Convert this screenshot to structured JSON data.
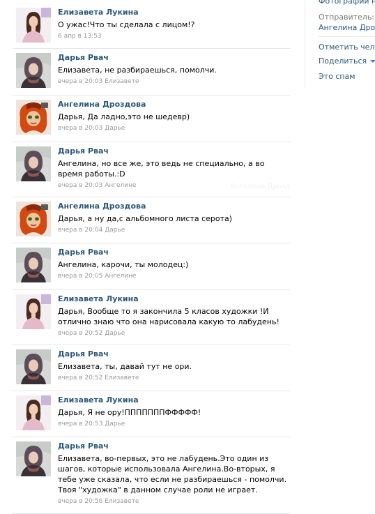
{
  "sidebar": {
    "top_link": "Фотографии на",
    "sender_label": "Отправитель:",
    "sender_name": "Ангелина Дрозд",
    "mark_people": "Отметить челов",
    "share": "Поделиться",
    "spam": "Это спам"
  },
  "watermark": "Ангелина Дрозд",
  "comments": [
    {
      "author": "Елизавета Лукина",
      "avatar": "liza",
      "text": "О ужас!Что ты сделала с лицом!?",
      "meta": "6 апр в 13:53"
    },
    {
      "author": "Дарья Рвач",
      "avatar": "daria",
      "text": "Елизавета, не разбираешься, помолчи.",
      "meta": "вчера в 20:03 Елизавете"
    },
    {
      "author": "Ангелина Дроздова",
      "avatar": "angelina",
      "text": "Дарья, Да ладно,это не шедевр)",
      "meta": "вчера в 20:03 Дарье"
    },
    {
      "author": "Дарья Рвач",
      "avatar": "daria",
      "text": "Ангелина, но все же, это ведь не специально, а во время работы.:D",
      "meta": "вчера в 20:03 Ангелине"
    },
    {
      "author": "Ангелина Дроздова",
      "avatar": "angelina",
      "text": "Дарья, а ну да,с альбомного листа серота)",
      "meta": "вчера в 20:04 Дарье"
    },
    {
      "author": "Дарья Рвач",
      "avatar": "daria",
      "text": "Ангелина, карочи, ты молодец:)",
      "meta": "вчера в 20:05 Ангелине"
    },
    {
      "author": "Елизавета Лукина",
      "avatar": "liza",
      "text": "Дарья, Вообще то я закончила 5 класов художки !И отлично знаю что она нарисовала какую то лабудень!",
      "meta": "вчера в 20:52 Дарье"
    },
    {
      "author": "Дарья Рвач",
      "avatar": "daria",
      "text": "Елизавета, ты, давай тут не ори.",
      "meta": "вчера в 20:52 Елизавете"
    },
    {
      "author": "Елизавета Лукина",
      "avatar": "liza",
      "text": "Дарья, Я не ору!ПППППППФФФФФ!",
      "meta": "вчера в 20:53 Дарье"
    },
    {
      "author": "Дарья Рвач",
      "avatar": "daria",
      "text": "Елизавета, во-первых, это не лабудень.Это один из шагов, которые использовала Ангелина.Во-вторых, я тебе уже сказала, что если не разбираешься - помолчи. Твоя \"художка\" в данном случае роли не играет.",
      "meta": "вчера в 20:56 Елизавете"
    }
  ]
}
